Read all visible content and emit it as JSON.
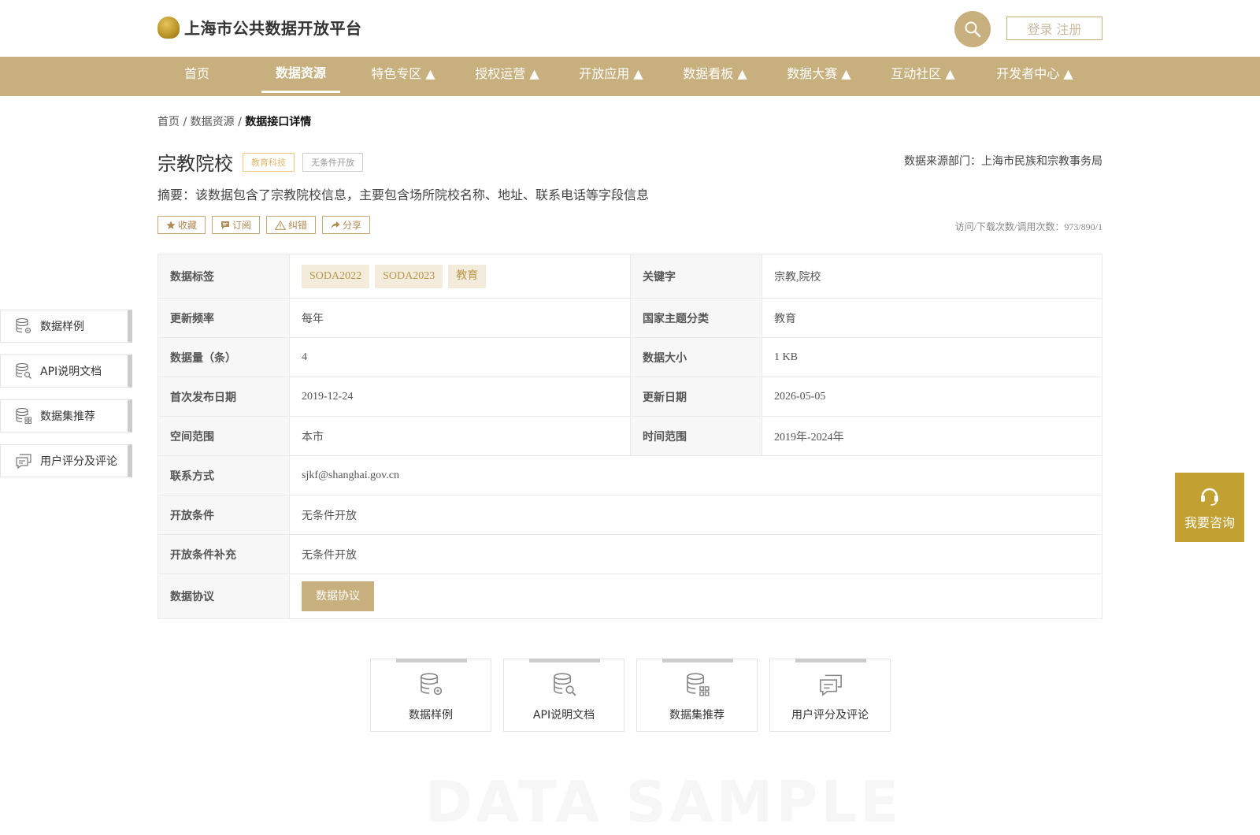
{
  "header": {
    "logo_text": "上海市公共数据开放平台",
    "login_label": "登录 注册"
  },
  "nav": [
    {
      "label": "首页"
    },
    {
      "label": "数据资源"
    },
    {
      "label": "特色专区 ▲"
    },
    {
      "label": "授权运营 ▲"
    },
    {
      "label": "开放应用 ▲"
    },
    {
      "label": "数据看板 ▲"
    },
    {
      "label": "数据大赛 ▲"
    },
    {
      "label": "互动社区 ▲"
    },
    {
      "label": "开发者中心 ▲"
    }
  ],
  "breadcrumb": {
    "home": "首页",
    "sep": "/",
    "section": "数据资源",
    "current": "数据接口详情"
  },
  "dataset": {
    "title": "宗教院校",
    "category_tag": "教育科技",
    "open_tag": "无条件开放",
    "source": "数据来源部门：上海市民族和宗教事务局",
    "summary": "摘要：该数据包含了宗教院校信息，主要包含场所院校名称、地址、联系电话等字段信息",
    "stats": "访问/下载次数/调用次数：973/890/1"
  },
  "actions": {
    "favorite": "收藏",
    "subscribe": "订阅",
    "report": "纠错",
    "share": "分享"
  },
  "table": {
    "tags_label": "数据标签",
    "tags": [
      "SODA2022",
      "SODA2023",
      "教育"
    ],
    "keyword_label": "关键字",
    "keyword": "宗教,院校",
    "freq_label": "更新频率",
    "freq": "每年",
    "theme_label": "国家主题分类",
    "theme": "教育",
    "count_label": "数据量（条）",
    "count": "4",
    "size_label": "数据大小",
    "size": "1 KB",
    "first_label": "首次发布日期",
    "first": "2019-12-24",
    "updated_label": "更新日期",
    "updated": "2026-05-05",
    "space_label": "空间范围",
    "space": "本市",
    "time_label": "时间范围",
    "time": "2019年-2024年",
    "contact_label": "联系方式",
    "contact": "sjkf@shanghai.gov.cn",
    "cond_label": "开放条件",
    "cond": "无条件开放",
    "cond_sup_label": "开放条件补充",
    "cond_sup": "无条件开放",
    "protocol_label": "数据协议",
    "protocol_btn": "数据协议"
  },
  "side_nav": [
    {
      "label": "数据样例",
      "icon": "database-gear-icon"
    },
    {
      "label": "API说明文档",
      "icon": "database-search-icon"
    },
    {
      "label": "数据集推荐",
      "icon": "database-grid-icon"
    },
    {
      "label": "用户评分及评论",
      "icon": "comment-icon"
    }
  ],
  "cards": [
    {
      "label": "数据样例",
      "icon": "database-gear-icon"
    },
    {
      "label": "API说明文档",
      "icon": "database-search-icon"
    },
    {
      "label": "数据集推荐",
      "icon": "database-grid-icon"
    },
    {
      "label": "用户评分及评论",
      "icon": "comment-icon"
    }
  ],
  "consult_label": "我要咨询",
  "watermark": "DATA SAMPLE",
  "colors": {
    "brand": "#c8b07e",
    "consult": "#c2a032",
    "chip_bg": "#f3ebdc"
  }
}
